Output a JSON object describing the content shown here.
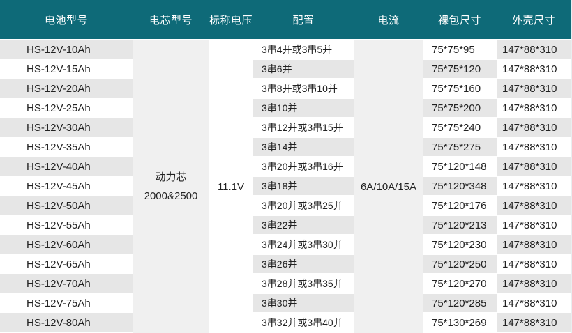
{
  "headers": {
    "model": "电池型号",
    "cell_type": "电芯型号",
    "voltage": "标称电压",
    "config": "配置",
    "current": "电流",
    "bare_size": "裸包尺寸",
    "shell_size": "外壳尺寸"
  },
  "merged": {
    "cell_type_line1": "动力芯",
    "cell_type_line2": "2000&2500",
    "voltage": "11.1V",
    "current": "6A/10A/15A"
  },
  "colors": {
    "header_bg": "#0e6a78",
    "stripe": "#e6e6e6",
    "merged_bg": "#f0f0f0"
  },
  "rows": [
    {
      "model": "HS-12V-10Ah",
      "config": "3串4并或3串5并",
      "bare": "75*75*95",
      "shell": "147*88*310"
    },
    {
      "model": "HS-12V-15Ah",
      "config": "3串6并",
      "bare": "75*75*120",
      "shell": "147*88*310"
    },
    {
      "model": "HS-12V-20Ah",
      "config": "3串8并或3串10并",
      "bare": "75*75*160",
      "shell": "147*88*310"
    },
    {
      "model": "HS-12V-25Ah",
      "config": "3串10并",
      "bare": "75*75*200",
      "shell": "147*88*310"
    },
    {
      "model": "HS-12V-30Ah",
      "config": "3串12并或3串15并",
      "bare": "75*75*240",
      "shell": "147*88*310"
    },
    {
      "model": "HS-12V-35Ah",
      "config": "3串14并",
      "bare": "75*75*275",
      "shell": "147*88*310"
    },
    {
      "model": "HS-12V-40Ah",
      "config": "3串20并或3串16并",
      "bare": "75*120*148",
      "shell": "147*88*310"
    },
    {
      "model": "HS-12V-45Ah",
      "config": "3串18并",
      "bare": "75*120*348",
      "shell": "147*88*310"
    },
    {
      "model": "HS-12V-50Ah",
      "config": "3串20并或3串25并",
      "bare": "75*120*176",
      "shell": "147*88*310"
    },
    {
      "model": "HS-12V-55Ah",
      "config": "3串22并",
      "bare": "75*120*213",
      "shell": "147*88*310"
    },
    {
      "model": "HS-12V-60Ah",
      "config": "3串24并或3串30并",
      "bare": "75*120*230",
      "shell": "147*88*310"
    },
    {
      "model": "HS-12V-65Ah",
      "config": "3串26并",
      "bare": "75*120*250",
      "shell": "147*88*310"
    },
    {
      "model": "HS-12V-70Ah",
      "config": "3串28并或3串35并",
      "bare": "75*120*270",
      "shell": "147*88*310"
    },
    {
      "model": "HS-12V-75Ah",
      "config": "3串30并",
      "bare": "75*120*285",
      "shell": "147*88*310"
    },
    {
      "model": "HS-12V-80Ah",
      "config": "3串32并或3串40并",
      "bare": "75*130*269",
      "shell": "147*88*310"
    }
  ]
}
